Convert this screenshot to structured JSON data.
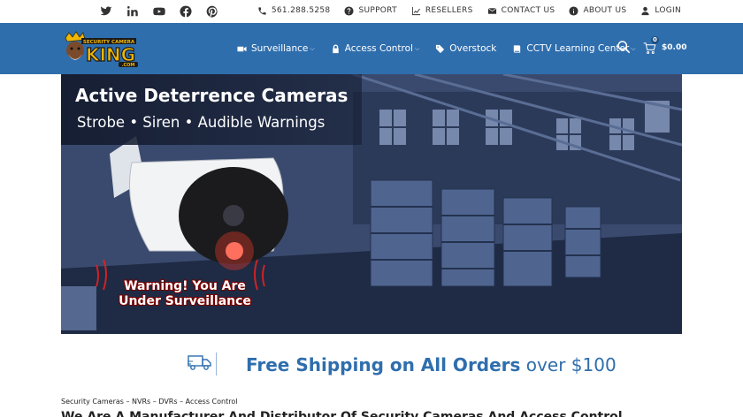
{
  "topbar": {
    "social": [
      {
        "icon": "twitter-icon"
      },
      {
        "icon": "linkedin-icon"
      },
      {
        "icon": "youtube-icon"
      },
      {
        "icon": "facebook-icon"
      },
      {
        "icon": "pinterest-icon"
      }
    ],
    "phone": "561.288.5258",
    "support": "SUPPORT",
    "resellers": "RESELLERS",
    "contact": "CONTACT US",
    "about": "ABOUT US",
    "login": "LOGIN"
  },
  "nav": {
    "logo_alt": "Security Camera King .com",
    "items": [
      {
        "label": "Surveillance",
        "icon": "video-camera-icon"
      },
      {
        "label": "Access Control",
        "icon": "lock-icon"
      },
      {
        "label": "Overstock",
        "icon": "tag-icon"
      },
      {
        "label": "CCTV Learning Center",
        "icon": "book-icon"
      }
    ],
    "cart_count": "0",
    "cart_total": "$0.00"
  },
  "hero": {
    "title": "Active Deterrence Cameras",
    "subtitle": "Strobe • Siren • Audible Warnings",
    "warning_line1": "Warning! You Are",
    "warning_line2": "Under Surveillance"
  },
  "shipping": {
    "strong": "Free Shipping on All Orders",
    "rest": " over $100"
  },
  "breadcrumb": "Security Cameras – NVRs – DVRs – Access Control",
  "cutoff_heading": "We Are A Manufacturer And Distributor Of Security Cameras And Access Control",
  "colors": {
    "brand_blue": "#2f6ead"
  }
}
